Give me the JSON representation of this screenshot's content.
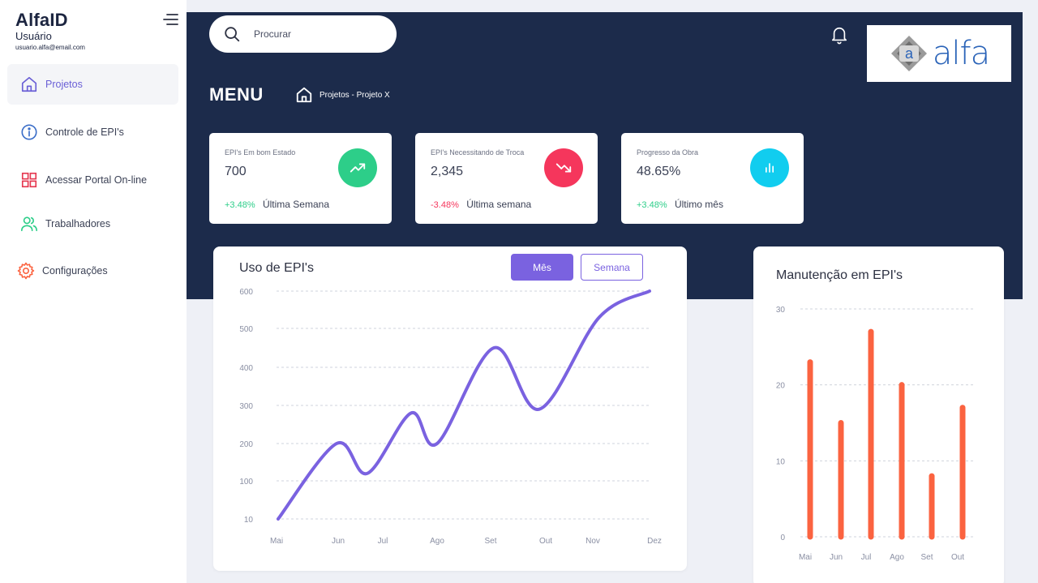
{
  "sidebar": {
    "brand": "AlfaID",
    "user": "Usuário",
    "email": "usuario.alfa@email.com",
    "items": [
      {
        "label": "Projetos",
        "icon": "home-icon",
        "active": true
      },
      {
        "label": "Controle de EPI's",
        "icon": "info-icon",
        "active": false
      },
      {
        "label": "Acessar Portal On-line",
        "icon": "grid-icon",
        "active": false
      },
      {
        "label": "Trabalhadores",
        "icon": "users-icon",
        "active": false
      },
      {
        "label": "Configurações",
        "icon": "gear-icon",
        "active": false
      }
    ]
  },
  "header": {
    "search_placeholder": "Procurar",
    "menu_title": "MENU",
    "breadcrumb": "Projetos - Projeto X",
    "logo_text": "alfa"
  },
  "stats": [
    {
      "label": "EPI's Em bom Estado",
      "value": "700",
      "delta": "+3.48%",
      "period": "Última Semana",
      "delta_color": "#2dce89",
      "badge_color": "#2dce89",
      "icon": "trending-up-icon"
    },
    {
      "label": "EPI's Necessitando de Troca",
      "value": "2,345",
      "delta": "-3.48%",
      "period": "Última semana",
      "delta_color": "#f5365c",
      "badge_color": "#f5365c",
      "icon": "trending-down-icon"
    },
    {
      "label": "Progresso da Obra",
      "value": "48.65%",
      "delta": "+3.48%",
      "period": "Último mês",
      "delta_color": "#2dce89",
      "badge_color": "#11cdef",
      "icon": "bar-chart-icon"
    }
  ],
  "usage_card": {
    "title": "Uso de EPI's",
    "btn_month": "Mês",
    "btn_week": "Semana"
  },
  "maint_card": {
    "title": "Manutenção em EPI's"
  },
  "chart_data": [
    {
      "type": "line",
      "title": "Uso de EPI's",
      "color": "#7a62e0",
      "grid": true,
      "x": [
        "Mai",
        "Jun",
        "Jul",
        "Ago",
        "Set",
        "Out",
        "Nov",
        "Dez"
      ],
      "y_ticks": [
        "600",
        "500",
        "400",
        "300",
        "200",
        "100",
        "10"
      ],
      "points": [
        {
          "x": "Mai",
          "y": 10
        },
        {
          "x": "",
          "y": 200
        },
        {
          "x": "Jul",
          "y": 120
        },
        {
          "x": "",
          "y": 280
        },
        {
          "x": "Ago",
          "y": 200
        },
        {
          "x": "",
          "y": 450
        },
        {
          "x": "Out",
          "y": 290
        },
        {
          "x": "",
          "y": 530
        },
        {
          "x": "Dez",
          "y": 600
        }
      ]
    },
    {
      "type": "bar",
      "title": "Manutenção em EPI's",
      "color": "#fb6340",
      "grid": true,
      "categories": [
        "Mai",
        "Jun",
        "Jul",
        "Ago",
        "Set",
        "Out"
      ],
      "values": [
        23,
        15,
        27,
        20,
        8,
        17
      ],
      "y_ticks": [
        "30",
        "20",
        "10",
        "0"
      ],
      "ylim": [
        0,
        30
      ]
    }
  ]
}
